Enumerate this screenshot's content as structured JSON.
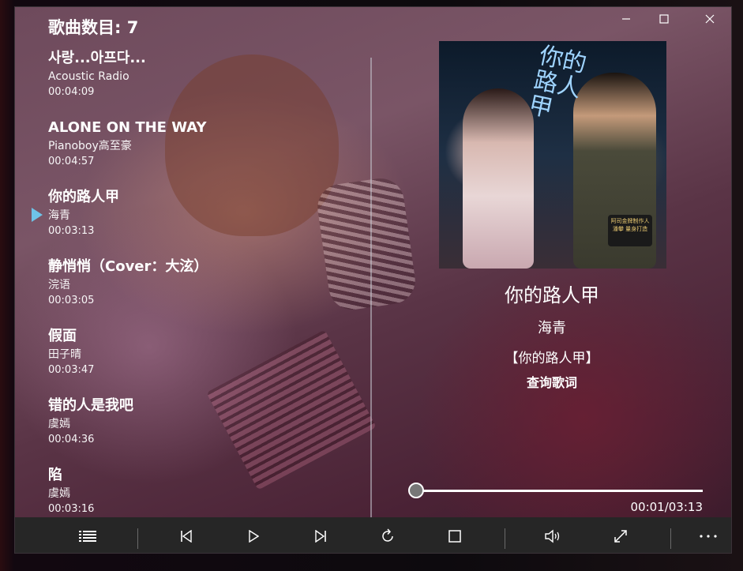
{
  "window": {
    "controls": [
      "minimize-icon",
      "maximize-icon",
      "close-icon"
    ]
  },
  "playlist": {
    "count_label": "歌曲数目: 7",
    "now_playing_index": 2,
    "songs": [
      {
        "title": "사랑...아프다...",
        "artist": "Acoustic Radio",
        "duration": "00:04:09"
      },
      {
        "title": "ALONE ON THE WAY",
        "artist": "Pianoboy高至豪",
        "duration": "00:04:57"
      },
      {
        "title": "你的路人甲",
        "artist": "海青",
        "duration": "00:03:13"
      },
      {
        "title": "静悄悄（Cover：大泫）",
        "artist": "浣语",
        "duration": "00:03:05"
      },
      {
        "title": "假面",
        "artist": "田子晴",
        "duration": "00:03:47"
      },
      {
        "title": "错的人是我吧",
        "artist": "虞嫣",
        "duration": "00:04:36"
      },
      {
        "title": "陷",
        "artist": "虞嫣",
        "duration": "00:03:16"
      }
    ]
  },
  "now_playing": {
    "title": "你的路人甲",
    "artist": "海青",
    "album": "【你的路人甲】",
    "lyrics_link": "查询歌词",
    "cover_text": "你的路人甲",
    "cover_badge": "阿司金牌制作人 潘攀 量身打造",
    "progress_fraction": 0.005,
    "elapsed": "00:01",
    "total": "03:13",
    "time_display": "00:01/03:13"
  },
  "toolbar": {
    "icons": [
      "playlist-icon",
      "previous-icon",
      "play-icon",
      "repeat-icon",
      "stop-icon",
      "volume-icon",
      "fullscreen-icon",
      "more-icon"
    ]
  }
}
